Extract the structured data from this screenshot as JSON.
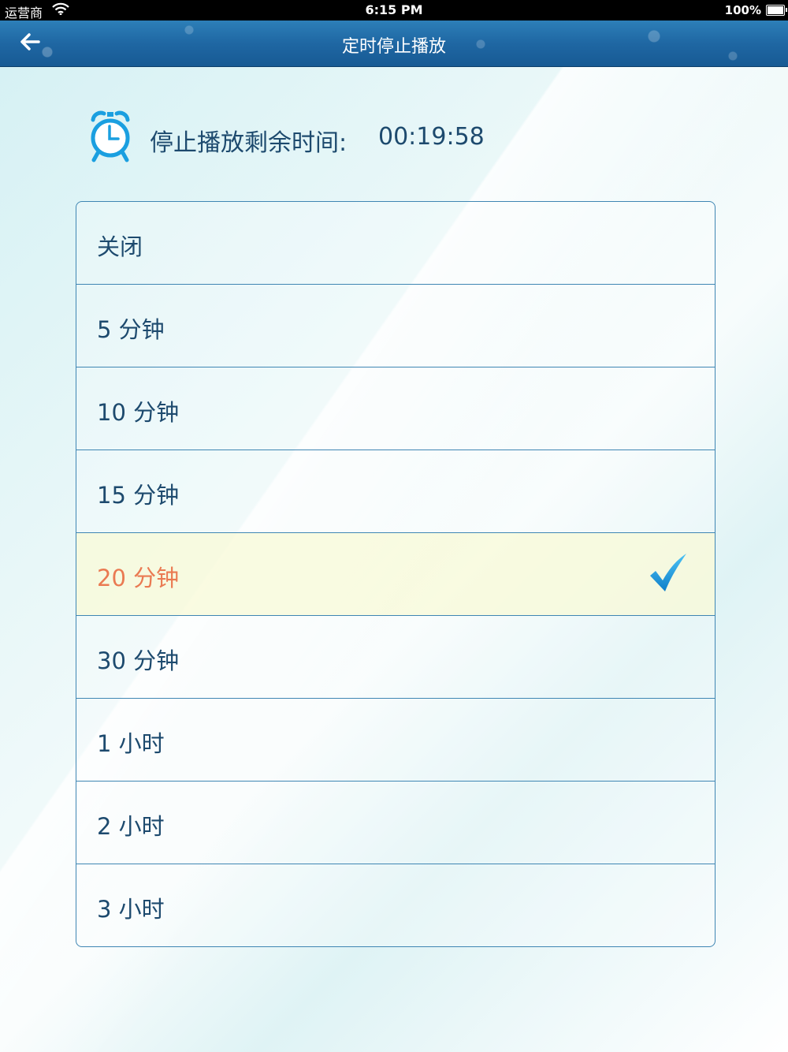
{
  "status_bar": {
    "carrier": "运营商",
    "time": "6:15 PM",
    "battery": "100%"
  },
  "nav": {
    "title": "定时停止播放",
    "back_icon": "back-arrow-icon"
  },
  "timer": {
    "icon": "alarm-clock-icon",
    "label": "停止播放剩余时间:",
    "remaining": "00:19:58"
  },
  "options": [
    {
      "label": "关闭",
      "selected": false
    },
    {
      "label": "5 分钟",
      "selected": false
    },
    {
      "label": "10 分钟",
      "selected": false
    },
    {
      "label": "15 分钟",
      "selected": false
    },
    {
      "label": "20 分钟",
      "selected": true
    },
    {
      "label": "30 分钟",
      "selected": false
    },
    {
      "label": "1 小时",
      "selected": false
    },
    {
      "label": "2 小时",
      "selected": false
    },
    {
      "label": "3 小时",
      "selected": false
    }
  ],
  "colors": {
    "accent": "#1a9fe0",
    "selected_text": "#ea7a52",
    "nav_bg": "#1f67a3",
    "text": "#1d4a6e"
  }
}
